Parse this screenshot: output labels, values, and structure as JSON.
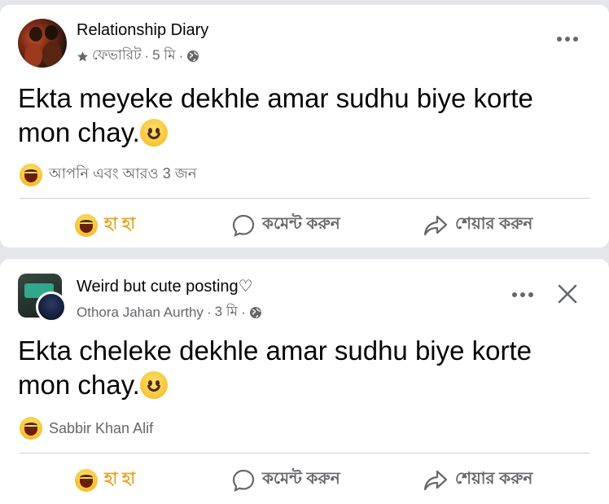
{
  "posts": [
    {
      "page_name": "Relationship Diary",
      "meta_label": "ফেভারিট",
      "time": "5 মি",
      "text_line1": "Ekta meyeke dekhle amar sudhu biye korte",
      "text_line2": "mon chay.",
      "reaction_summary": "আপনি এবং আরও 3 জন",
      "actions": {
        "react": "হা হা",
        "comment": "কমেন্ট করুন",
        "share": "শেয়ার করুন"
      }
    },
    {
      "page_name": "Weird but cute posting♡",
      "meta_label": "Othora Jahan Aurthy",
      "time": "3 মি",
      "text_line1": "Ekta cheleke dekhle amar sudhu biye korte",
      "text_line2": "mon chay.",
      "reaction_summary": "Sabbir Khan Alif",
      "actions": {
        "react": "হা হা",
        "comment": "কমেন্ট করুন",
        "share": "শেয়ার করুন"
      }
    }
  ],
  "colors": {
    "background": "#e4e6eb",
    "card": "#ffffff",
    "secondary_text": "#65676b",
    "haha_accent": "#e8a320"
  },
  "icons": [
    "star-icon",
    "globe-icon",
    "more-options-icon",
    "close-icon",
    "smile-emoji-icon",
    "haha-reaction-icon",
    "comment-icon",
    "share-icon"
  ]
}
